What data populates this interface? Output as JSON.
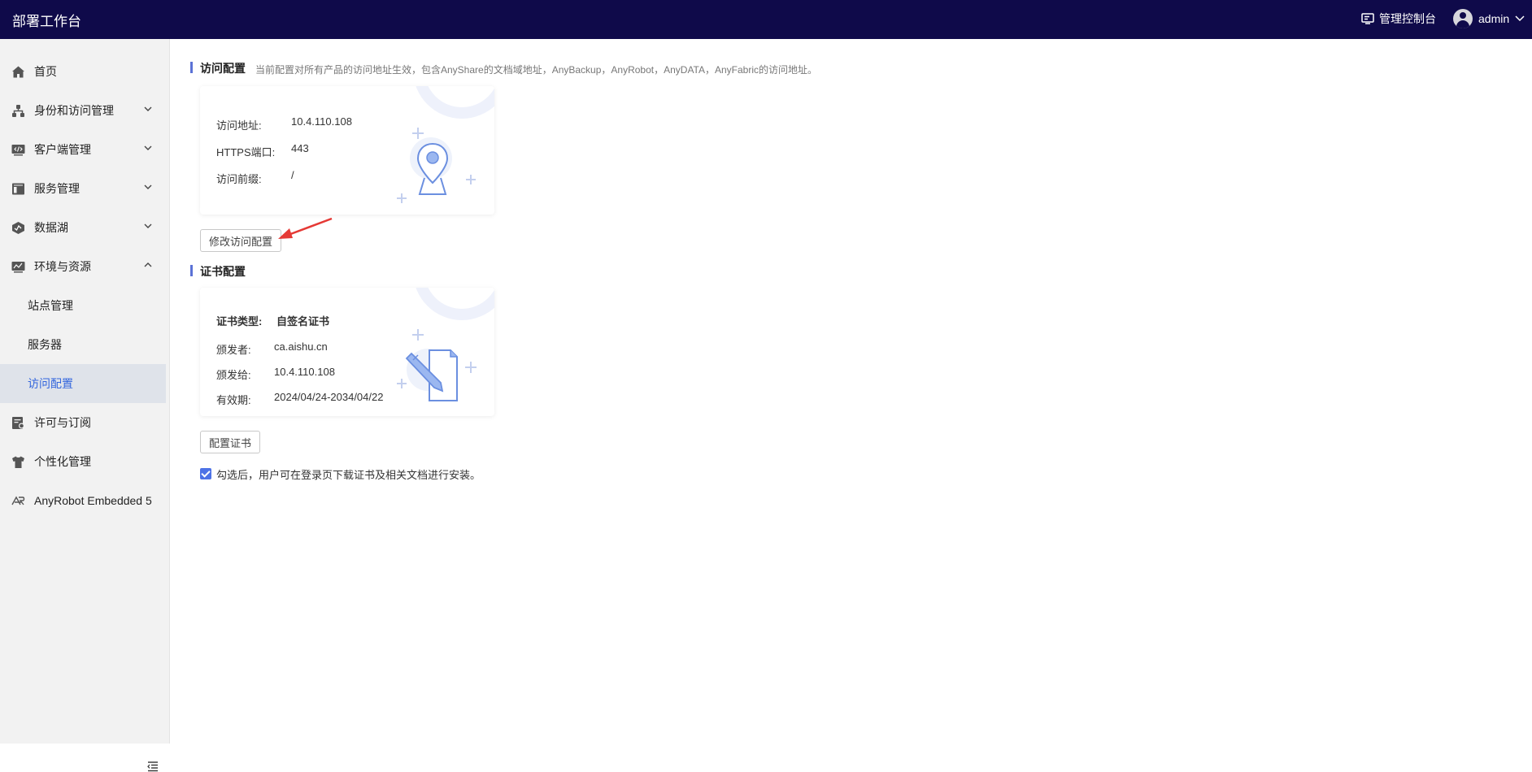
{
  "header": {
    "title": "部署工作台",
    "console_label": "管理控制台",
    "username": "admin"
  },
  "sidebar": {
    "items": [
      {
        "label": "首页",
        "icon": "home-icon"
      },
      {
        "label": "身份和访问管理",
        "icon": "org-icon"
      },
      {
        "label": "客户端管理",
        "icon": "client-icon"
      },
      {
        "label": "服务管理",
        "icon": "service-icon"
      },
      {
        "label": "数据湖",
        "icon": "datalake-icon"
      },
      {
        "label": "环境与资源",
        "icon": "environment-icon"
      },
      {
        "label": "站点管理"
      },
      {
        "label": "服务器"
      },
      {
        "label": "访问配置"
      },
      {
        "label": "许可与订阅",
        "icon": "license-icon"
      },
      {
        "label": "个性化管理",
        "icon": "shirt-icon"
      },
      {
        "label": "AnyRobot Embedded 5",
        "icon": "anyrobot-logo-icon"
      }
    ]
  },
  "access_config": {
    "title": "访问配置",
    "description": "当前配置对所有产品的访问地址生效，包含AnyShare的文档域地址，AnyBackup，AnyRobot，AnyDATA，AnyFabric的访问地址。",
    "address_label": "访问地址:",
    "address_value": "10.4.110.108",
    "port_label": "HTTPS端口:",
    "port_value": "443",
    "prefix_label": "访问前缀:",
    "prefix_value": "/",
    "edit_button": "修改访问配置"
  },
  "cert_config": {
    "title": "证书配置",
    "type_label": "证书类型:",
    "type_value": "自签名证书",
    "issuer_label": "颁发者:",
    "issuer_value": "ca.aishu.cn",
    "issued_to_label": "颁发给:",
    "issued_to_value": "10.4.110.108",
    "validity_label": "有效期:",
    "validity_value": "2024/04/24-2034/04/22",
    "config_button": "配置证书",
    "checkbox_label": "勾选后，用户可在登录页下载证书及相关文档进行安装。",
    "checkbox_checked": true
  },
  "colors": {
    "header_bg": "#0f0a4a",
    "accent": "#4d72e6",
    "active_text": "#3366dd",
    "annotation_arrow": "#e53935"
  }
}
